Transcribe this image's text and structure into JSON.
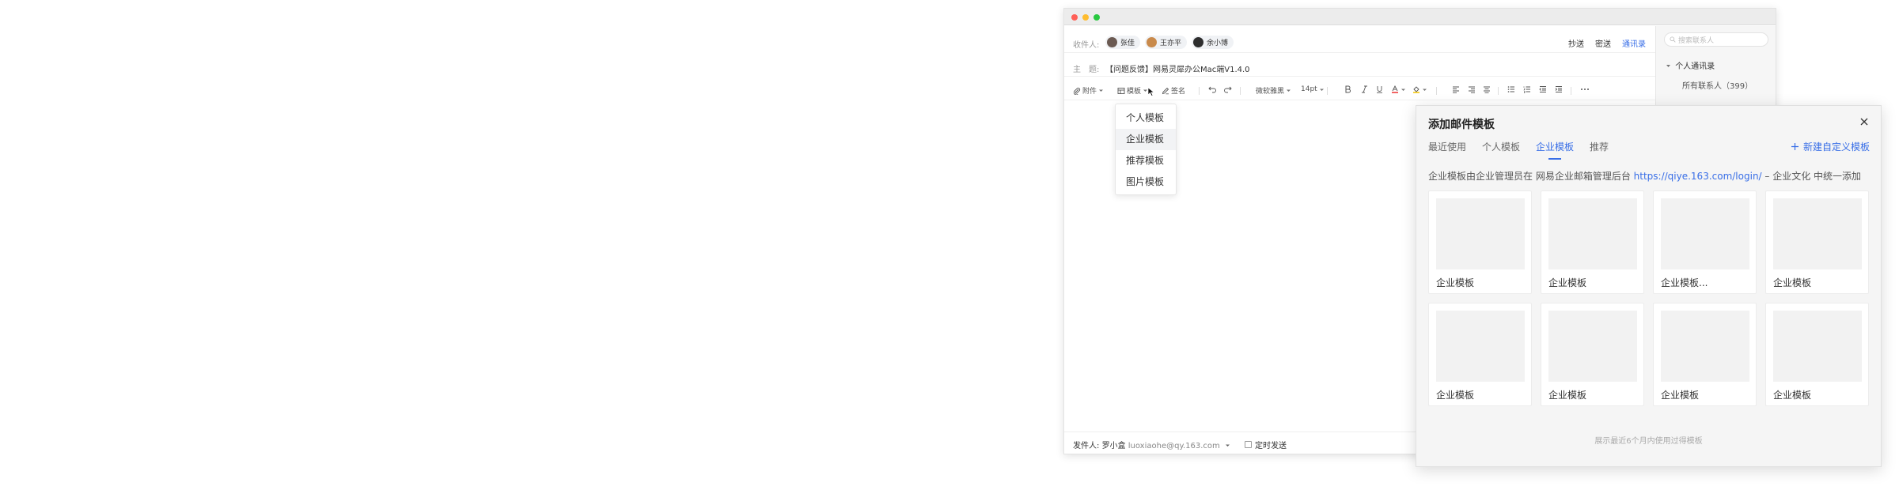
{
  "compose": {
    "to_label": "收件人:",
    "recipients": [
      "张佳",
      "王亦平",
      "余小博"
    ],
    "links": {
      "cc": "抄送",
      "bcc": "密送",
      "contacts": "通讯录"
    },
    "subject_label": "主　题:",
    "subject": "【问题反馈】网易灵犀办公Mac端V1.4.0"
  },
  "toolbar": {
    "attach": "附件",
    "template": "模板",
    "signature": "签名",
    "font": "微软雅黑",
    "size": "14pt"
  },
  "template_menu": {
    "items": [
      "个人模板",
      "企业模板",
      "推荐模板",
      "图片模板"
    ],
    "active_index": 1
  },
  "footer": {
    "from_label": "发件人:",
    "sender_name": "罗小盒",
    "sender_email": "luoxiaohe@qy.163.com",
    "scheduled": "定时发送"
  },
  "contacts_panel": {
    "search_placeholder": "搜索联系人",
    "group": "个人通讯录",
    "all_contacts": "所有联系人（399）"
  },
  "template_panel": {
    "title": "添加邮件模板",
    "tabs": [
      "最近使用",
      "个人模板",
      "企业模板",
      "推荐"
    ],
    "active_tab": 2,
    "new_button": "新建自定义模板",
    "desc_prefix": "企业模板由企业管理员在 网易企业邮箱管理后台",
    "desc_link": "https://qiye.163.com/login/",
    "desc_suffix": "– 企业文化 中统一添加",
    "cards": [
      "企业模板",
      "企业模板",
      "企业模板...",
      "企业模板",
      "企业模板",
      "企业模板",
      "企业模板",
      "企业模板"
    ],
    "footnote": "展示最近6个月内使用过得模板"
  },
  "colors": {
    "accent": "#386ee7"
  }
}
